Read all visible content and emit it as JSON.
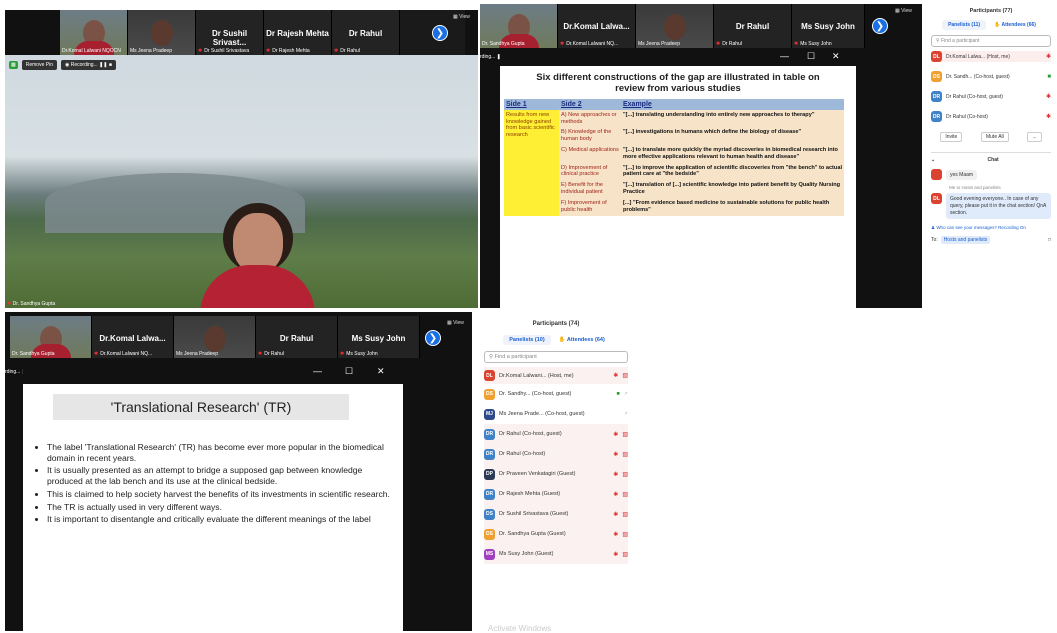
{
  "q1": {
    "tiles": [
      {
        "caption": "Dr.Komal Lalwani NQOCN"
      },
      {
        "caption": "Ms Jeena Pradeep"
      },
      {
        "name": "Dr Sushil Srivast...",
        "caption": "Dr Sushil Srivastava"
      },
      {
        "name": "Dr Rajesh Mehta",
        "caption": "Dr Rajesh Mehta"
      },
      {
        "name": "Dr Rahul",
        "caption": "Dr Rahul"
      }
    ],
    "view_label": "View",
    "toolbar": {
      "remove_pin": "Remove Pin",
      "recording": "Recording..."
    },
    "speaker_caption": "Dr. Sandhya Gupta"
  },
  "q2": {
    "tiles": [
      {
        "caption": "Dr. Sandhya Gupta"
      },
      {
        "name": "Dr.Komal Lalwa...",
        "caption": "Dr.Komal Lalwani NQ..."
      },
      {
        "caption": "Ms Jeena Pradeep"
      },
      {
        "name": "Dr Rahul",
        "caption": "Dr Rahul"
      },
      {
        "name": "Ms Susy John",
        "caption": "Ms Susy John"
      }
    ],
    "view_label": "View",
    "recording_fragment": "rding...",
    "slide": {
      "title_line1": "Six different constructions of the gap are illustrated in table on",
      "title_line2": "review from various studies",
      "headers": [
        "Side 1",
        "Side 2",
        "Example"
      ],
      "side1": "Results from new knowledge gained from basic scientific research",
      "rows": [
        {
          "side2": "A) New approaches or methods",
          "example": "\"[...] translating understanding into entirely new approaches to therapy\""
        },
        {
          "side2": "B) Knowledge of the human body",
          "example": "\"[...] investigations in humans which define the biology of disease\""
        },
        {
          "side2": "C) Medical applications",
          "example": "\"[...] to translate more quickly the myriad discoveries in biomedical research into more effective applications relevant to human health and disease\""
        },
        {
          "side2": "D) Improvement of clinical practice",
          "example": "\"[...] to improve the application of scientific discoveries from \"the bench\" to actual patient care at \"the bedside\""
        },
        {
          "side2": "E) Benefit for the individual patient",
          "example": "\"[...] translation of [...] scientific knowledge into patient benefit by Quality Nursing Practice"
        },
        {
          "side2": "F) Improvement of public health",
          "example": "[...] \"From evidence based medicine to sustainable solutions for public health problems\""
        }
      ]
    }
  },
  "q2panel": {
    "title": "Participants (77)",
    "tab_panelists": "Panelists (11)",
    "tab_attendees": "Attendees (66)",
    "search_placeholder": "Find a participant",
    "rows": [
      {
        "initials": "DL",
        "color": "#d9432f",
        "name": "Dr.Komal Lalwa... (Host, me)"
      },
      {
        "initials": "DS",
        "color": "#f0a030",
        "name": "Dr. Sandh... (Co-host, guest)"
      },
      {
        "initials": "DR",
        "color": "#3f82c8",
        "name": "Dr Rahul (Co-host, guest)"
      },
      {
        "initials": "DR",
        "color": "#3f82c8",
        "name": "Dr Rahul (Co-host)"
      }
    ],
    "btn_invite": "Invite",
    "btn_mute_all": "Mute All",
    "btn_more": "...",
    "chat_title": "Chat",
    "chat_msg1": "yes Maam",
    "chat_to": "Me to Hosts and panelists",
    "chat_msg2": "Good evening everyone.. In case of any query, please put it in the chat section/ QnA section.",
    "who_can_see": "Who can see your messages? Recording On",
    "to_label": "To:",
    "to_value": "Hosts and panelists"
  },
  "q3": {
    "tiles": [
      {
        "caption": "Dr. Sandhya Gupta"
      },
      {
        "name": "Dr.Komal Lalwa...",
        "caption": "Dr.Komal Lalwani NQ..."
      },
      {
        "caption": "Ms Jeena Pradeep"
      },
      {
        "name": "Dr Rahul",
        "caption": "Dr Rahul"
      },
      {
        "name": "Ms Susy John",
        "caption": "Ms Susy John"
      }
    ],
    "view_label": "View",
    "recording_fragment": "rding...",
    "slide": {
      "title": "'Translational Research' (TR)",
      "bullets": [
        "The label 'Translational Research' (TR) has become ever more popular in the biomedical domain in recent years.",
        "It is usually presented as an attempt to bridge a supposed gap between knowledge produced at the lab bench and its use at the clinical bedside.",
        "This is claimed to help society harvest the benefits of its investments in scientific research.",
        "The TR  is actually used in very different ways.",
        "It is important to disentangle and critically evaluate the different meanings of the label"
      ]
    }
  },
  "q4panel": {
    "title": "Participants (74)",
    "tab_panelists": "Panelists (10)",
    "tab_attendees": "Attendees (64)",
    "search_placeholder": "Find a participant",
    "rows": [
      {
        "initials": "DL",
        "color": "#d9432f",
        "name": "Dr.Komal Lalwani... (Host, me)"
      },
      {
        "initials": "DS",
        "color": "#f0a030",
        "name": "Dr. Sandhy... (Co-host, guest)"
      },
      {
        "initials": "MJ",
        "color": "#2f4a8a",
        "name": "Ms Jeena Prade... (Co-host, guest)"
      },
      {
        "initials": "DR",
        "color": "#3f82c8",
        "name": "Dr Rahul (Co-host, guest)"
      },
      {
        "initials": "DR",
        "color": "#3f82c8",
        "name": "Dr Rahul (Co-host)"
      },
      {
        "initials": "DP",
        "color": "#2b3a55",
        "name": "Dr Praveen Venkatagiri (Guest)"
      },
      {
        "initials": "DR",
        "color": "#3f82c8",
        "name": "Dr Rajesh Mehta (Guest)"
      },
      {
        "initials": "DS",
        "color": "#3f82c8",
        "name": "Dr Sushil Srivastava (Guest)"
      },
      {
        "initials": "DS",
        "color": "#f0a030",
        "name": "Dr. Sandhya Gupta (Guest)"
      },
      {
        "initials": "MS",
        "color": "#a040c0",
        "name": "Ms Susy John (Guest)"
      }
    ],
    "footer": "Activate Windows"
  }
}
